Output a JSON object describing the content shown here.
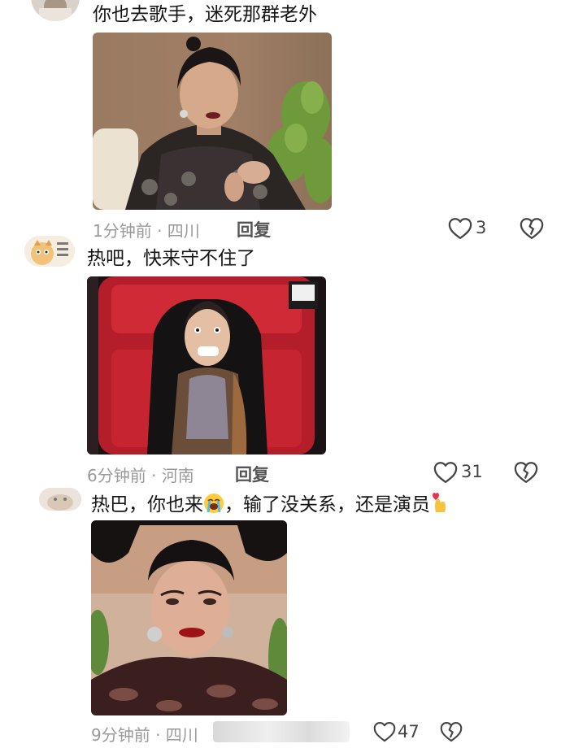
{
  "comments": [
    {
      "text": "你也去歌手，迷死那群老外",
      "meta": "1分钟前 · 四川",
      "reply_label": "回复",
      "likes": "3"
    },
    {
      "text": "热吧，快来守不住了",
      "meta": "6分钟前 · 河南",
      "reply_label": "回复",
      "likes": "31"
    },
    {
      "text_part1": "热巴，你也来",
      "text_part2": "，输了没关系，还是演员",
      "meta": "9分钟前 · 四川",
      "likes": "47"
    }
  ],
  "icons": {
    "like": "heart-outline-icon",
    "dislike": "broken-heart-icon",
    "crying_emoji": "loudly-crying-face-icon",
    "finger_heart_emoji": "finger-heart-icon"
  },
  "colors": {
    "text": "#161616",
    "meta": "#9a9a9a",
    "icon": "#444444"
  }
}
